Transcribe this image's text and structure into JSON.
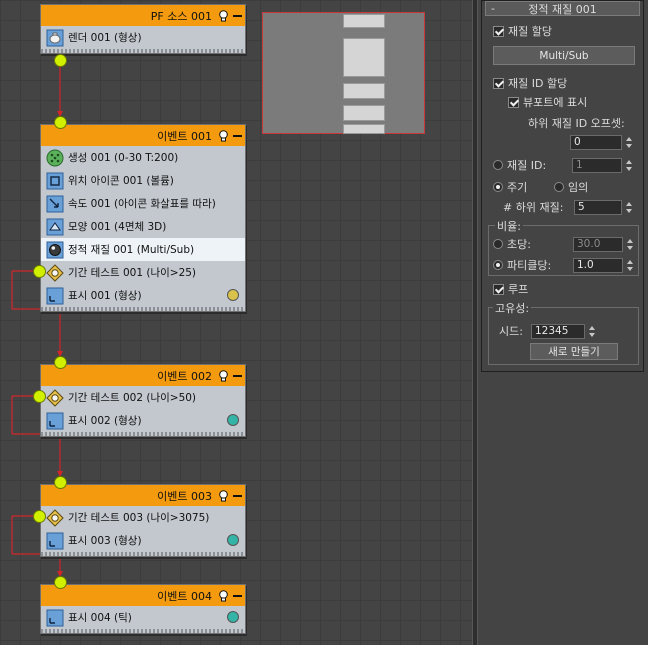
{
  "graph": {
    "nodes": [
      {
        "title": "PF 소스 001",
        "ops": [
          {
            "icon": "teapot-render-icon",
            "label": "렌더 001 (형상)"
          }
        ]
      },
      {
        "title": "이벤트 001",
        "ops": [
          {
            "icon": "birth-grid-icon",
            "label": "생성 001 (0-30 T:200)"
          },
          {
            "icon": "position-icon-icon",
            "label": "위치 아이콘 001 (볼륨)"
          },
          {
            "icon": "speed-icon",
            "label": "속도 001 (아이콘 화살표를 따라)"
          },
          {
            "icon": "shape-icon",
            "label": "모양 001 (4면체 3D)"
          },
          {
            "icon": "material-sphere-icon",
            "label": "정적 재질 001 (Multi/Sub)"
          },
          {
            "icon": "age-test-diamond-icon",
            "label": "기간 테스트 001 (나이>25)"
          },
          {
            "icon": "display-icon",
            "label": "표시 001 (형상)"
          }
        ]
      },
      {
        "title": "이벤트 002",
        "ops": [
          {
            "icon": "age-test-diamond-icon",
            "label": "기간 테스트 002 (나이>50)"
          },
          {
            "icon": "display-icon",
            "label": "표시 002 (형상)"
          }
        ]
      },
      {
        "title": "이벤트 003",
        "ops": [
          {
            "icon": "age-test-diamond-icon",
            "label": "기간 테스트 003 (나이>3075)"
          },
          {
            "icon": "display-icon",
            "label": "표시 003 (형상)"
          }
        ]
      },
      {
        "title": "이벤트 004",
        "ops": [
          {
            "icon": "display-icon",
            "label": "표시 004 (틱)"
          }
        ]
      }
    ],
    "display_colors": {
      "event1": "#d8c24a",
      "event2": "#34b3a7",
      "event3": "#34b3a7",
      "event4": "#34b3a7"
    },
    "header_color": "#f39a0f",
    "wire_color": "#d0262a",
    "port_color": "#d0f000"
  },
  "panel": {
    "rollout_collapse": "-",
    "rollout_title": "정적 재질 001",
    "assign_material": {
      "label": "재질 할당",
      "checked": true
    },
    "material_button": "Multi/Sub",
    "assign_material_id": {
      "label": "재질 ID 할당",
      "checked": true
    },
    "show_in_viewport": {
      "label": "뷰포트에 표시",
      "checked": true
    },
    "sub_id_offset_label": "하위 재질 ID 오프셋:",
    "sub_id_offset_value": "0",
    "material_id_label": "재질 ID:",
    "material_id_value": "1",
    "cycle_label": "주기",
    "random_label": "임의",
    "num_sub_label": "# 하위 재질:",
    "num_sub_value": "5",
    "rate_group": "비율:",
    "per_second_label": "초당:",
    "per_second_value": "30.0",
    "per_particle_label": "파티클당:",
    "per_particle_value": "1.0",
    "loop": {
      "label": "루프",
      "checked": true
    },
    "uniqueness_group": "고유성:",
    "seed_label": "시드:",
    "seed_value": "12345",
    "new_button": "새로 만들기"
  }
}
